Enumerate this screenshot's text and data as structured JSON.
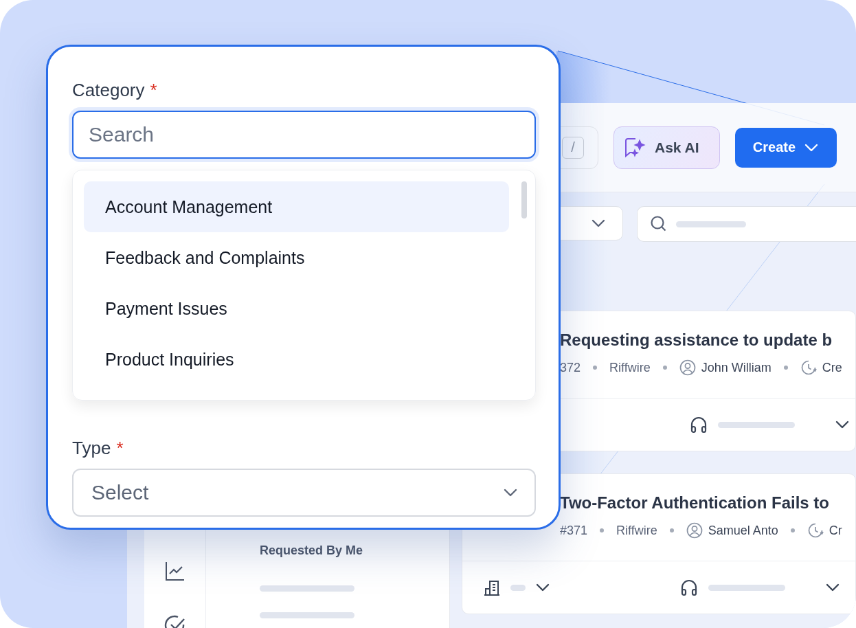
{
  "popup": {
    "category": {
      "label": "Category",
      "required_mark": "*",
      "search_placeholder": "Search",
      "options": [
        {
          "label": "Account Management",
          "selected": true
        },
        {
          "label": "Feedback and Complaints",
          "selected": false
        },
        {
          "label": "Payment Issues",
          "selected": false
        },
        {
          "label": "Product Inquiries",
          "selected": false
        }
      ]
    },
    "type": {
      "label": "Type",
      "required_mark": "*",
      "placeholder": "Select"
    }
  },
  "toolbar": {
    "shortcut_key": "/",
    "ask_ai": "Ask AI",
    "create": "Create"
  },
  "list_panel": {
    "heading": "Requested By Me"
  },
  "tickets": [
    {
      "title": "Requesting assistance to update b",
      "number": "372",
      "company": "Riffwire",
      "requester": "John William",
      "created": "Cre"
    },
    {
      "title": "Two-Factor Authentication Fails to",
      "number": "#371",
      "company": "Riffwire",
      "requester": "Samuel Anto",
      "created": "Cr"
    }
  ]
}
